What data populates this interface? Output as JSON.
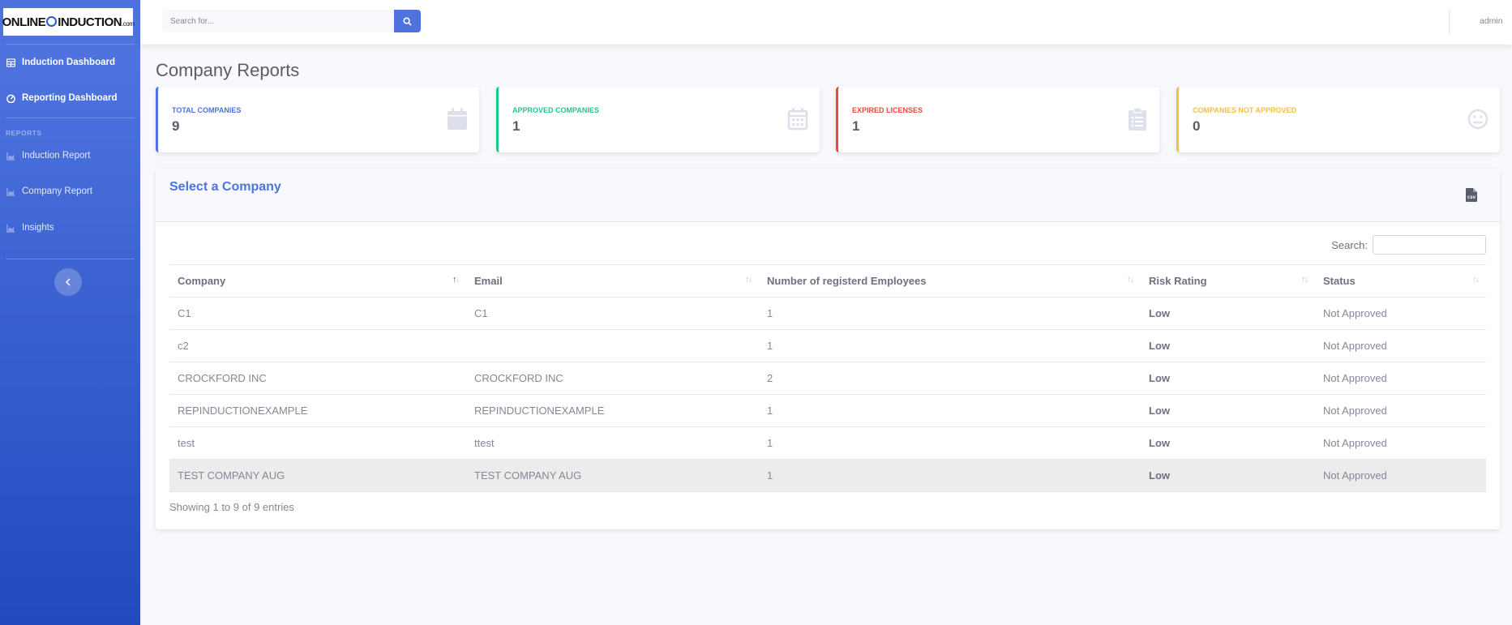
{
  "sidebar": {
    "logo": {
      "part1": "ONLINE",
      "part2": "INDUCTION",
      "part3": ".com"
    },
    "items_top": [
      {
        "label": "Induction Dashboard",
        "icon": "table-icon"
      },
      {
        "label": "Reporting Dashboard",
        "icon": "gauge-icon"
      }
    ],
    "heading": "REPORTS",
    "items_reports": [
      {
        "label": "Induction Report",
        "icon": "chart-area-icon"
      },
      {
        "label": "Company Report",
        "icon": "chart-area-icon"
      },
      {
        "label": "Insights",
        "icon": "chart-area-icon"
      }
    ],
    "toggle_icon": "chevron-left-icon"
  },
  "topbar": {
    "search_placeholder": "Search for...",
    "search_icon": "search-icon",
    "user": "admin"
  },
  "page_title": "Company Reports",
  "cards": [
    {
      "label": "TOTAL COMPANIES",
      "value": "9",
      "color": "#4e73df",
      "icon": "calendar-icon"
    },
    {
      "label": "APPROVED COMPANIES",
      "value": "1",
      "color": "#1cc88a",
      "icon": "calendar-grid-icon"
    },
    {
      "label": "EXPIRED LICENSES",
      "value": "1",
      "color": "#e74a3b",
      "icon": "clipboard-list-icon"
    },
    {
      "label": "COMPANIES NOT APPROVED",
      "value": "0",
      "color": "#f6c23e",
      "icon": "meh-face-icon"
    }
  ],
  "panel": {
    "title": "Select a Company",
    "export_icon": "csv-file-icon",
    "search_label": "Search:",
    "columns": [
      "Company",
      "Email",
      "Number of registerd Employees",
      "Risk Rating",
      "Status"
    ],
    "rows": [
      [
        "C1",
        "C1",
        "1",
        "Low",
        "Not Approved"
      ],
      [
        "c2",
        "",
        "1",
        "Low",
        "Not Approved"
      ],
      [
        "CROCKFORD INC",
        "CROCKFORD INC",
        "2",
        "Low",
        "Not Approved"
      ],
      [
        "REPINDUCTIONEXAMPLE",
        "REPINDUCTIONEXAMPLE",
        "1",
        "Low",
        "Not Approved"
      ],
      [
        "test",
        "ttest",
        "1",
        "Low",
        "Not Approved"
      ],
      [
        "TEST COMPANY AUG",
        "TEST COMPANY AUG",
        "1",
        "Low",
        "Not Approved"
      ]
    ],
    "info": "Showing 1 to 9 of 9 entries"
  }
}
